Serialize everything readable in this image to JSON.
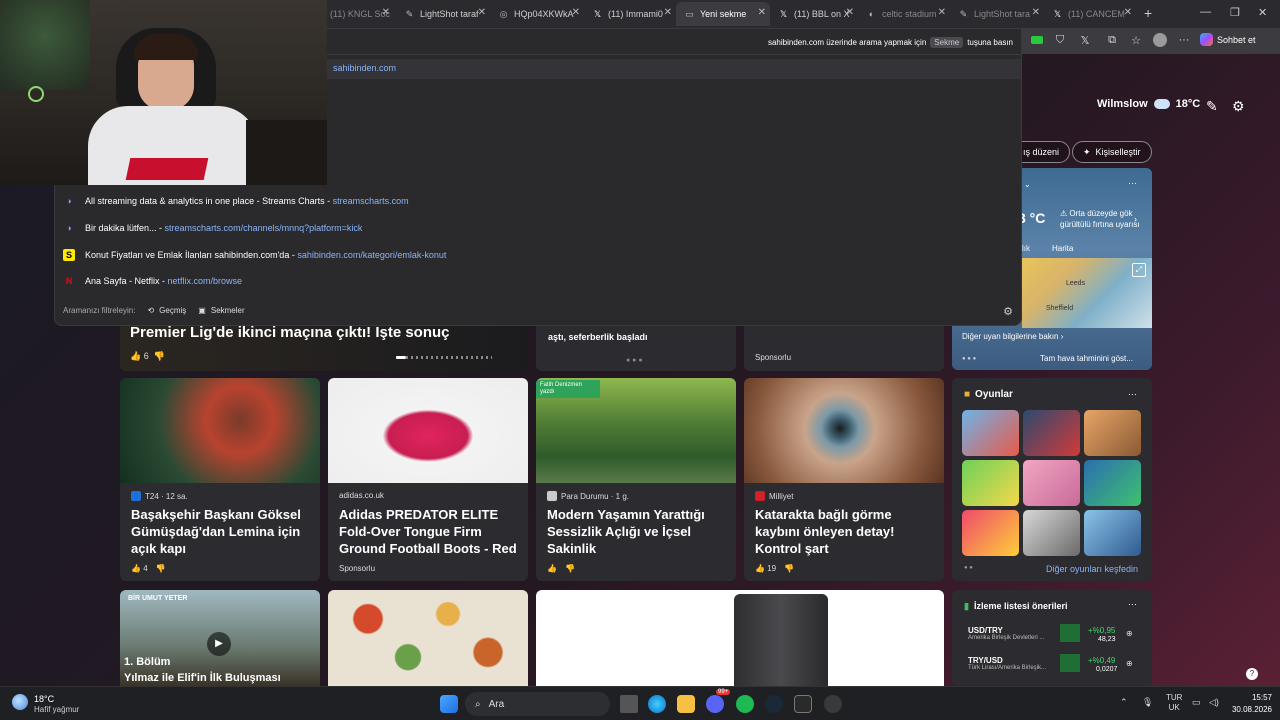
{
  "tabs": [
    {
      "label": "(11) KNGL Soci",
      "icon": "youtube-icon"
    },
    {
      "label": "LightShot taraf",
      "icon": "lightshot-icon"
    },
    {
      "label": "HQp04XKWkA",
      "icon": "globe-icon"
    },
    {
      "label": "(11) Immami0",
      "icon": "x-icon"
    },
    {
      "label": "Yeni sekme",
      "icon": "tab-icon"
    },
    {
      "label": "(11) BBL on X",
      "icon": "x-icon"
    },
    {
      "label": "celtic stadium",
      "icon": "search-icon"
    },
    {
      "label": "LightShot tara",
      "icon": "lightshot-icon"
    },
    {
      "label": "(11) CANCEM",
      "icon": "x-icon"
    }
  ],
  "toolbar": {
    "sohbet_label": "Sohbet et"
  },
  "omnibox": {
    "hint_prefix": "sahibinden.com üzerinde arama yapmak için",
    "hint_key": "Sekme",
    "hint_suffix": "tuşuna basın",
    "input_value": "sahibinden.com",
    "suggestions": [
      {
        "title": "All streaming data & analytics in one place - Streams Charts",
        "url": "streamscharts.com",
        "icon": "streamscharts-icon"
      },
      {
        "title": "Bir dakika lütfen...",
        "url": "streamscharts.com/channels/mnnq?platform=kick",
        "icon": "streamscharts-icon"
      },
      {
        "title": "Konut Fiyatları ve Emlak İlanları sahibinden.com'da",
        "url": "sahibinden.com/kategori/emlak-konut",
        "icon": "sahibinden-icon"
      },
      {
        "title": "Ana Sayfa - Netflix",
        "url": "netflix.com/browse",
        "icon": "netflix-icon"
      }
    ],
    "filter_label": "Aramanızı filtreleyin:",
    "filter_history": "Geçmiş",
    "filter_tabs": "Sekmeler"
  },
  "weather": {
    "city": "Wilmslow",
    "temp": "18°C",
    "alert": "Orta düzeyde gök gürültülü fırtına uyarısı",
    "tab_map": "Harita",
    "tab_other": "lık",
    "more": "Diğer uyan bilgilerine bakın",
    "forecast": "Tam hava tahminini göst...",
    "temp_partial": "3 °C",
    "map_labels": [
      "Leeds",
      "Sheffield"
    ]
  },
  "header_buttons": {
    "layout": "ış düzeni",
    "personalize": "Kişiselleştir"
  },
  "top_row": {
    "headline": "Premier Lig'de ikinci maçına çıktı! İşte sonuç",
    "likes": "6",
    "middle_text": "aştı, seferberlik başladı",
    "sponsored": "Sponsorlu"
  },
  "cards": [
    {
      "source": "T24 · 12 sa.",
      "title": "Başakşehir Başkanı Göksel Gümüşdağ'dan Lemina için açık kapı",
      "likes": "4",
      "src_color": "#1e6fd9"
    },
    {
      "source": "adidas.co.uk",
      "title": "Adidas PREDATOR ELITE Fold-Over Tongue Firm Ground Football Boots - Red",
      "meta": "Sponsorlu",
      "src_color": ""
    },
    {
      "source": "Para Durumu · 1 g.",
      "title": "Modern Yaşamın Yarattığı Sessizlik Açlığı ve İçsel Sakinlik",
      "likes": "",
      "src_color": "#cccccc",
      "badge": "Fatih Denizmen yazdı"
    },
    {
      "source": "Milliyet",
      "title": "Katarakta bağlı görme kaybını önleyen detay! Kontrol şart",
      "likes": "19",
      "src_color": "#d0202a"
    }
  ],
  "games": {
    "title": "Oyunlar",
    "more": "Diğer oyunları keşfedin"
  },
  "watchlist": {
    "title": "İzleme listesi önerileri",
    "rows": [
      {
        "symbol": "USD/TRY",
        "name": "Amerika Birleşik Devletleri ...",
        "change": "+%0,95",
        "value": "48,23"
      },
      {
        "symbol": "TRY/USD",
        "name": "Türk Lirası/Amerika Birleşik...",
        "change": "+%0,49",
        "value": "0,0207"
      }
    ]
  },
  "bottom_row": {
    "video_text1": "BİR UMUT YETER",
    "video_text2": "1. Bölüm",
    "video_text3": "Yılmaz ile Elif'in İlk Buluşması"
  },
  "taskbar": {
    "weather_temp": "18°C",
    "weather_desc": "Hafif yağmur",
    "search_label": "Ara",
    "lang1": "TUR",
    "lang2": "UK",
    "time": "15:57",
    "date": "30.08.2026",
    "badge": "99+"
  }
}
